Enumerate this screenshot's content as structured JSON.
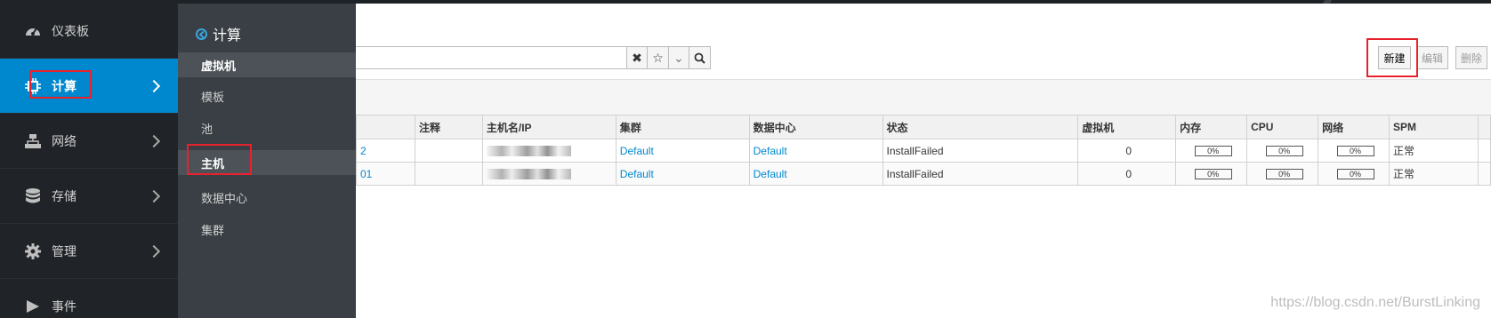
{
  "nav": {
    "items": [
      {
        "label": "仪表板",
        "icon": "dashboard-icon"
      },
      {
        "label": "计算",
        "icon": "compute-icon"
      },
      {
        "label": "网络",
        "icon": "network-icon"
      },
      {
        "label": "存储",
        "icon": "storage-icon"
      },
      {
        "label": "管理",
        "icon": "gear-icon"
      },
      {
        "label": "事件",
        "icon": "flag-icon"
      }
    ]
  },
  "submenu": {
    "title": "计算",
    "items": [
      "虚拟机",
      "模板",
      "池",
      "主机",
      "数据中心",
      "集群"
    ]
  },
  "search": {
    "clear": "✖",
    "bookmark": "☆",
    "dropdown": "⌄",
    "go": "⌕"
  },
  "toolbar": {
    "new_label": "新建",
    "edit_label": "编辑",
    "delete_label": "删除"
  },
  "table": {
    "headers": [
      "注释",
      "主机名/IP",
      "集群",
      "数据中心",
      "状态",
      "虚拟机",
      "内存",
      "CPU",
      "网络",
      "SPM"
    ],
    "rows": [
      {
        "name_tail": "2",
        "comment": "",
        "cluster": "Default",
        "datacenter": "Default",
        "status": "InstallFailed",
        "vms": "0",
        "memory": "0%",
        "cpu": "0%",
        "network": "0%",
        "spm": "正常"
      },
      {
        "name_tail": "01",
        "comment": "",
        "cluster": "Default",
        "datacenter": "Default",
        "status": "InstallFailed",
        "vms": "0",
        "memory": "0%",
        "cpu": "0%",
        "network": "0%",
        "spm": "正常"
      }
    ]
  },
  "watermark": "https://blog.csdn.net/BurstLinking",
  "colors": {
    "accent": "#0088ce",
    "highlight": "#e8212c"
  }
}
